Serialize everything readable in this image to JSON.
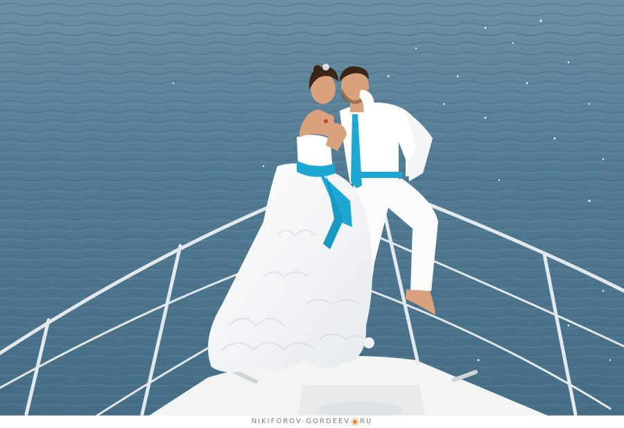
{
  "photo": {
    "subject": "bride-and-groom-on-yacht-bow",
    "colors": {
      "water": "#4f7890",
      "water_dark": "#3d6379",
      "sparkle": "#ffffff",
      "ribbon_accent": "#1ea7d3",
      "dress": "#f7f8fa",
      "suit": "#fbfbfb",
      "railing": "#e3e8ec",
      "deck": "#f3f4f4",
      "skin": "#d9a17c",
      "hair": "#3b2418"
    }
  },
  "watermark": {
    "part1": "NIKIFOROV",
    "separator": "-",
    "part2": "GORDEEV",
    "sun_icon": "sun-icon",
    "part3": "RU",
    "accent_color": "#ff7a1a",
    "text_color": "#7a7a7a"
  }
}
